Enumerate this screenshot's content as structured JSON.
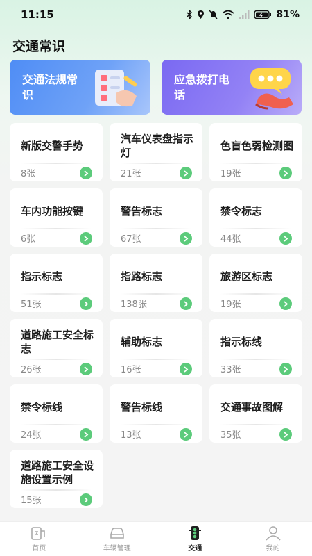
{
  "status": {
    "time": "11:15",
    "battery": "81%"
  },
  "page_title": "交通常识",
  "banners": [
    {
      "label": "交通法规常识"
    },
    {
      "label": "应急拨打电话"
    }
  ],
  "cards": [
    {
      "title": "新版交警手势",
      "count": "8张"
    },
    {
      "title": "汽车仪表盘指示灯",
      "count": "21张"
    },
    {
      "title": "色盲色弱检测图",
      "count": "19张"
    },
    {
      "title": "车内功能按键",
      "count": "6张"
    },
    {
      "title": "警告标志",
      "count": "67张"
    },
    {
      "title": "禁令标志",
      "count": "44张"
    },
    {
      "title": "指示标志",
      "count": "51张"
    },
    {
      "title": "指路标志",
      "count": "138张"
    },
    {
      "title": "旅游区标志",
      "count": "19张"
    },
    {
      "title": "道路施工安全标志",
      "count": "26张"
    },
    {
      "title": "辅助标志",
      "count": "16张"
    },
    {
      "title": "指示标线",
      "count": "33张"
    },
    {
      "title": "禁令标线",
      "count": "24张"
    },
    {
      "title": "警告标线",
      "count": "13张"
    },
    {
      "title": "交通事故图解",
      "count": "35张"
    },
    {
      "title": "道路施工安全设施设置示例",
      "count": "15张"
    }
  ],
  "nav": [
    {
      "label": "首页",
      "icon": "home-icon"
    },
    {
      "label": "车辆管理",
      "icon": "car-icon"
    },
    {
      "label": "交通",
      "icon": "traffic-light-icon",
      "active": true
    },
    {
      "label": "我的",
      "icon": "user-icon"
    }
  ],
  "colors": {
    "accent": "#5ccb7b",
    "banner_blue": "#4f8df5",
    "banner_purple": "#7a69f2"
  }
}
